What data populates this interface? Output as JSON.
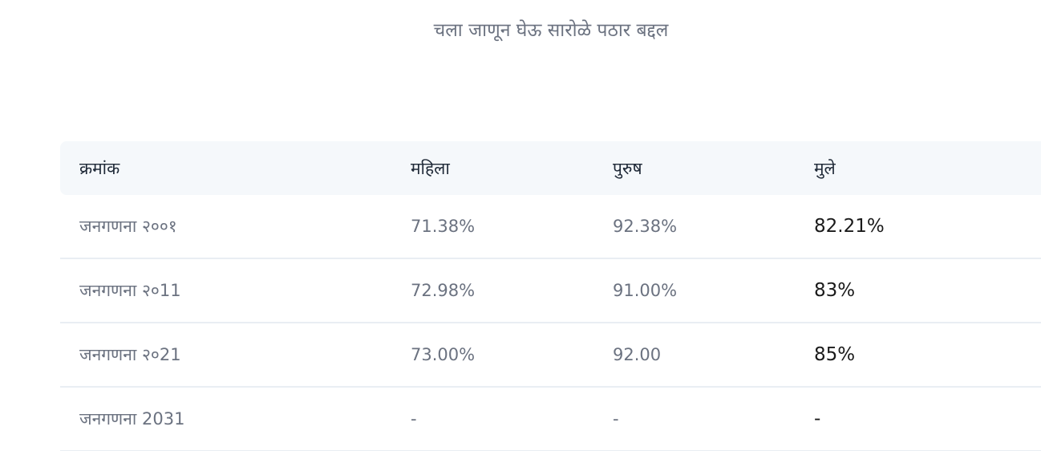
{
  "subtitle": "चला जाणून घेऊ सारोळे पठार बद्दल",
  "table": {
    "headers": [
      "क्रमांक",
      "महिला",
      "पुरुष",
      "मुले"
    ],
    "rows": [
      [
        "जनगणना २००१",
        "71.38%",
        "92.38%",
        "82.21%"
      ],
      [
        "जनगणना २०11",
        "72.98%",
        "91.00%",
        "83%"
      ],
      [
        "जनगणना २०21",
        "73.00%",
        "92.00",
        "85%"
      ],
      [
        "जनगणना 2031",
        "-",
        "-",
        "-"
      ]
    ]
  }
}
